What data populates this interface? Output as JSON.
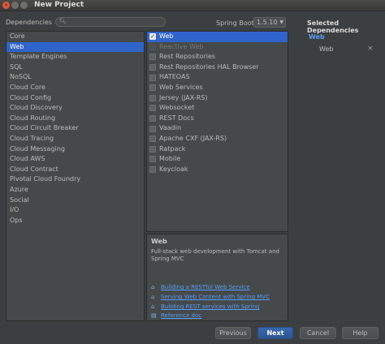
{
  "window": {
    "title": "New Project"
  },
  "toolbar": {
    "dependencies_label": "Dependencies",
    "search_placeholder": "",
    "spring_boot_label": "Spring Boot",
    "version": "1.5.10"
  },
  "categories": [
    {
      "label": "Core",
      "selected": false
    },
    {
      "label": "Web",
      "selected": true
    },
    {
      "label": "Template Engines",
      "selected": false
    },
    {
      "label": "SQL",
      "selected": false
    },
    {
      "label": "NoSQL",
      "selected": false
    },
    {
      "label": "Cloud Core",
      "selected": false
    },
    {
      "label": "Cloud Config",
      "selected": false
    },
    {
      "label": "Cloud Discovery",
      "selected": false
    },
    {
      "label": "Cloud Routing",
      "selected": false
    },
    {
      "label": "Cloud Circuit Breaker",
      "selected": false
    },
    {
      "label": "Cloud Tracing",
      "selected": false
    },
    {
      "label": "Cloud Messaging",
      "selected": false
    },
    {
      "label": "Cloud AWS",
      "selected": false
    },
    {
      "label": "Cloud Contract",
      "selected": false
    },
    {
      "label": "Pivotal Cloud Foundry",
      "selected": false
    },
    {
      "label": "Azure",
      "selected": false
    },
    {
      "label": "Social",
      "selected": false
    },
    {
      "label": "I/O",
      "selected": false
    },
    {
      "label": "Ops",
      "selected": false
    }
  ],
  "dependencies": [
    {
      "label": "Web",
      "checked": true,
      "selected": true,
      "disabled": false
    },
    {
      "label": "Reactive Web",
      "checked": false,
      "selected": false,
      "disabled": true
    },
    {
      "label": "Rest Repositories",
      "checked": false,
      "selected": false,
      "disabled": false
    },
    {
      "label": "Rest Repositories HAL Browser",
      "checked": false,
      "selected": false,
      "disabled": false
    },
    {
      "label": "HATEOAS",
      "checked": false,
      "selected": false,
      "disabled": false
    },
    {
      "label": "Web Services",
      "checked": false,
      "selected": false,
      "disabled": false
    },
    {
      "label": "Jersey (JAX-RS)",
      "checked": false,
      "selected": false,
      "disabled": false
    },
    {
      "label": "Websocket",
      "checked": false,
      "selected": false,
      "disabled": false
    },
    {
      "label": "REST Docs",
      "checked": false,
      "selected": false,
      "disabled": false
    },
    {
      "label": "Vaadin",
      "checked": false,
      "selected": false,
      "disabled": false
    },
    {
      "label": "Apache CXF (JAX-RS)",
      "checked": false,
      "selected": false,
      "disabled": false
    },
    {
      "label": "Ratpack",
      "checked": false,
      "selected": false,
      "disabled": false
    },
    {
      "label": "Mobile",
      "checked": false,
      "selected": false,
      "disabled": false
    },
    {
      "label": "Keycloak",
      "checked": false,
      "selected": false,
      "disabled": false
    }
  ],
  "description": {
    "title": "Web",
    "text": "Full-stack web development with Tomcat and Spring MVC",
    "links": [
      "Building a RESTful Web Service",
      "Serving Web Content with Spring MVC",
      "Building REST services with Spring",
      "Reference doc"
    ]
  },
  "selected_panel": {
    "title": "Selected Dependencies",
    "group": "Web",
    "item": "Web",
    "remove_glyph": "×"
  },
  "buttons": {
    "previous": "Previous",
    "next": "Next",
    "cancel": "Cancel",
    "help": "Help"
  },
  "colors": {
    "background": "#3c3f41",
    "selection": "#2f65ca",
    "link": "#589df6"
  }
}
